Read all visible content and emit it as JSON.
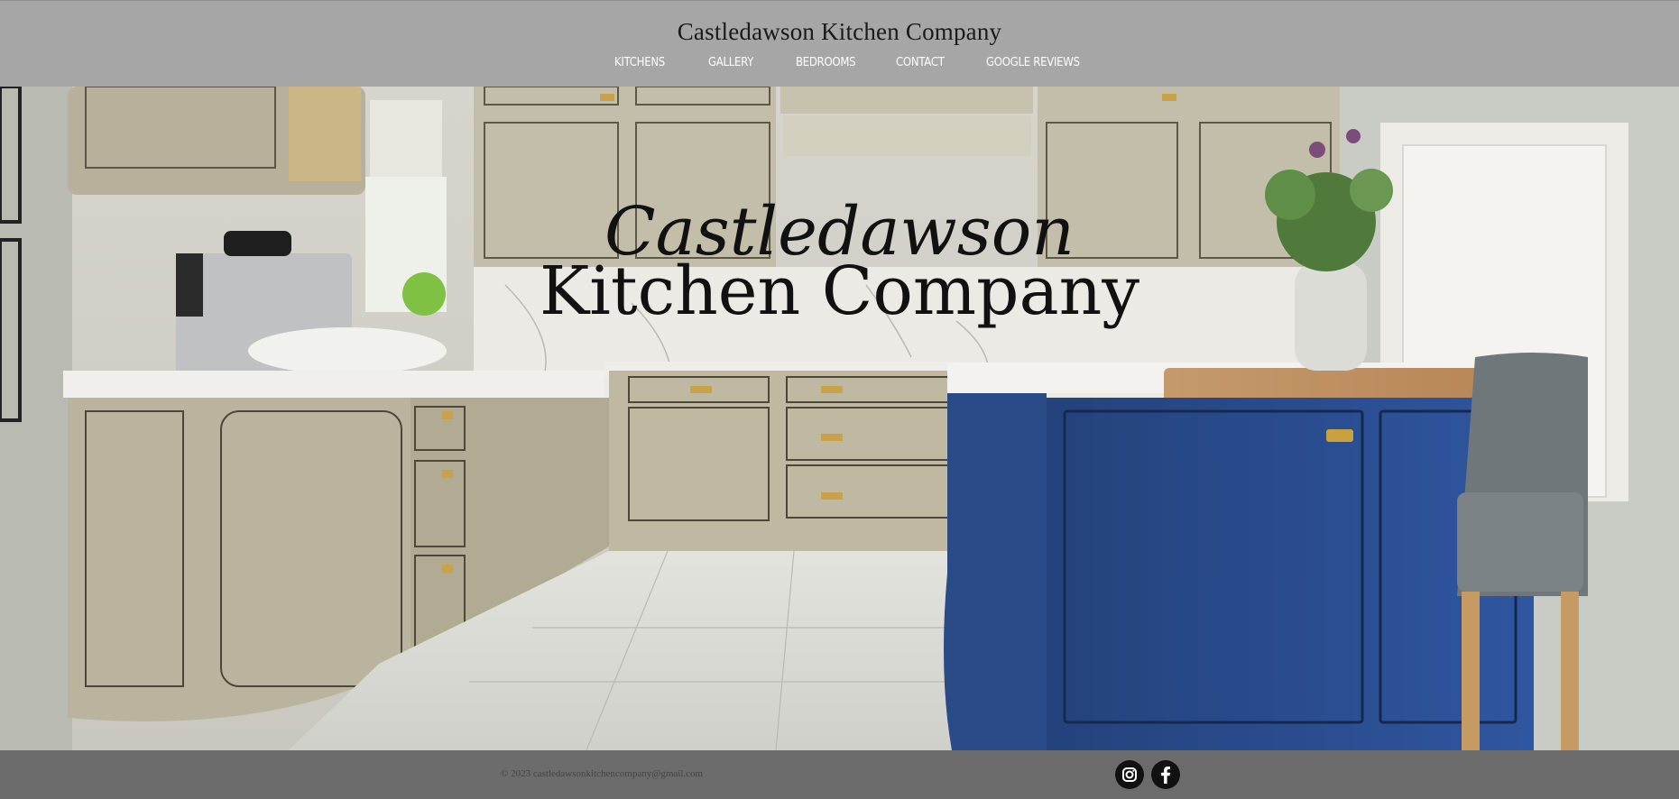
{
  "header": {
    "site_title": "Castledawson Kitchen Company",
    "nav": [
      "KITCHENS",
      "GALLERY",
      "BEDROOMS",
      "CONTACT",
      "GOOGLE REVIEWS"
    ]
  },
  "hero": {
    "title_line1": "Castledawson",
    "title_line2": "Kitchen Company"
  },
  "footer": {
    "copyright": "© 2023 castledawsonkitchencompany@gmail.com",
    "social": [
      "instagram-icon",
      "facebook-icon"
    ]
  },
  "colors": {
    "header_bg": "#a6a6a6",
    "footer_bg": "#6c6c6c",
    "cabinet_taupe": "#b8b29c",
    "island_blue": "#2d4f8f"
  }
}
